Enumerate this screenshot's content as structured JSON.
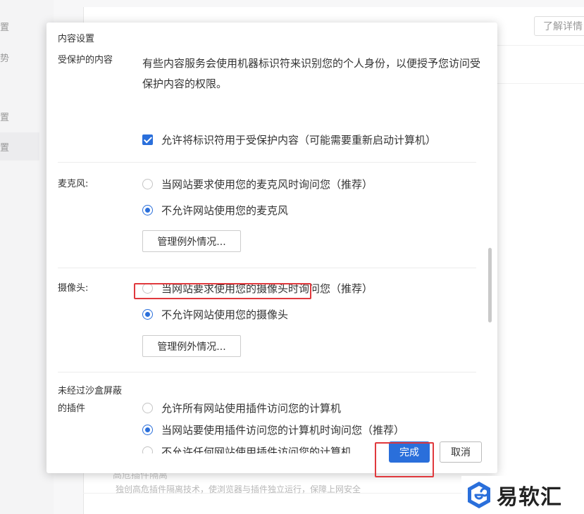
{
  "background": {
    "sidebar_items": [
      "置",
      "势",
      "置",
      "置"
    ],
    "learn_more_button": "了解详情",
    "plugin_isolation_title": "高危插件隔离",
    "plugin_isolation_desc": "独创高危插件隔离技术，使浏览器与插件独立运行，保障上网安全"
  },
  "dialog": {
    "title": "内容设置",
    "protected_content": {
      "label": "受保护的内容",
      "description": "有些内容服务会使用机器标识符来识别您的个人身份，以便授予您访问受保护内容的权限。",
      "checkbox_label": "允许将标识符用于受保护内容（可能需要重新启动计算机）",
      "checked": true
    },
    "microphone": {
      "label": "麦克风:",
      "options": [
        "当网站要求使用您的麦克风时询问您（推荐）",
        "不允许网站使用您的麦克风"
      ],
      "selected_index": 1,
      "manage_button": "管理例外情况..."
    },
    "camera": {
      "label": "摄像头:",
      "options": [
        "当网站要求使用您的摄像头时询问您（推荐）",
        "不允许网站使用您的摄像头"
      ],
      "selected_index": 1,
      "manage_button": "管理例外情况..."
    },
    "unsandboxed_plugins": {
      "label_line1": "未经过沙盒屏蔽",
      "label_line2": "的插件",
      "options": [
        "允许所有网站使用插件访问您的计算机",
        "当网站要使用插件访问您的计算机时询问您（推荐）",
        "不允许任何网站使用插件访问您的计算机"
      ],
      "selected_index": 1
    },
    "done_button": "完成",
    "cancel_button": "取消"
  },
  "watermark": {
    "text": "易软汇"
  },
  "colors": {
    "accent": "#2a6fdb",
    "highlight": "#e0393d"
  }
}
